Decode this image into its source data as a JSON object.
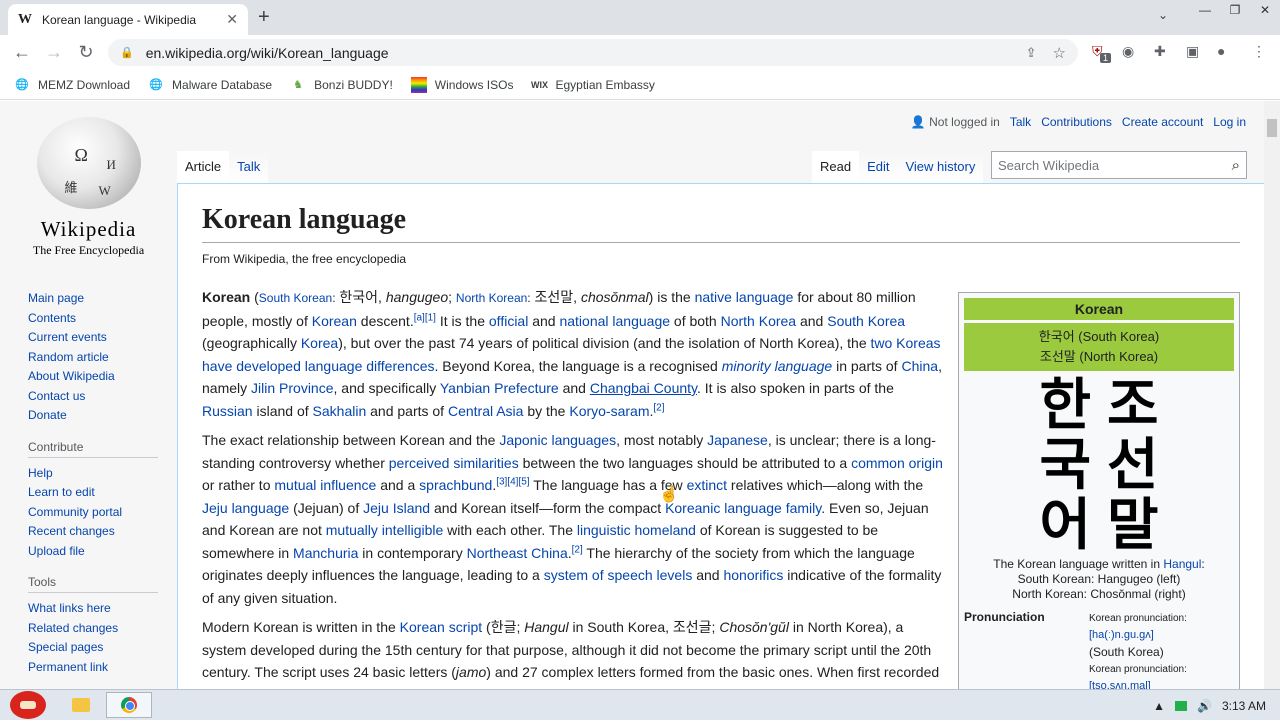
{
  "browser": {
    "tab_title": "Korean language - Wikipedia",
    "tab_favicon": "W",
    "url": "en.wikipedia.org/wiki/Korean_language",
    "bookmarks": [
      {
        "label": "MEMZ Download",
        "icon": "globe-icon"
      },
      {
        "label": "Malware Database",
        "icon": "globe-icon"
      },
      {
        "label": "Bonzi BUDDY!",
        "icon": "bonzi-icon"
      },
      {
        "label": "Windows ISOs",
        "icon": "windows-flag-icon"
      },
      {
        "label": "Egyptian Embassy",
        "icon": "wix-icon"
      }
    ],
    "extension_badge": "1"
  },
  "wiki": {
    "wordmark": "Wikipedia",
    "tagline": "The Free Encyclopedia",
    "nav_main": [
      "Main page",
      "Contents",
      "Current events",
      "Random article",
      "About Wikipedia",
      "Contact us",
      "Donate"
    ],
    "contribute_heading": "Contribute",
    "nav_contribute": [
      "Help",
      "Learn to edit",
      "Community portal",
      "Recent changes",
      "Upload file"
    ],
    "tools_heading": "Tools",
    "nav_tools": [
      "What links here",
      "Related changes",
      "Special pages",
      "Permanent link"
    ],
    "personal": {
      "anon": "Not logged in",
      "talk": "Talk",
      "contributions": "Contributions",
      "create": "Create account",
      "login": "Log in"
    },
    "tabs": {
      "article": "Article",
      "talk": "Talk",
      "read": "Read",
      "edit": "Edit",
      "history": "View history"
    },
    "search_placeholder": "Search Wikipedia",
    "title": "Korean language",
    "subtitle": "From Wikipedia, the free encyclopedia"
  },
  "infobox": {
    "title": "Korean",
    "name_sk": "한국어 (South Korea)",
    "name_nk": "조선말 (North Korea)",
    "glyphs_left": [
      "한",
      "국",
      "어"
    ],
    "glyphs_right": [
      "조",
      "선",
      "말"
    ],
    "caption_1": "The Korean language written in ",
    "caption_link": "Hangul",
    "caption_1_end": ":",
    "caption_2": "South Korean: Hangugeo (left)",
    "caption_3": "North Korean: Chosŏnmal (right)",
    "pron_label": "Pronunciation",
    "pron_sk_label": "Korean pronunciation:",
    "pron_sk_ipa": "[ha(ː)n.ɡu.ɡʌ]",
    "pron_sk_region": "(South Korea)",
    "pron_nk_label": "Korean pronunciation:",
    "pron_nk_ipa": "[tso.sʌn.mal]"
  },
  "taskbar": {
    "time": "3:13 AM"
  }
}
